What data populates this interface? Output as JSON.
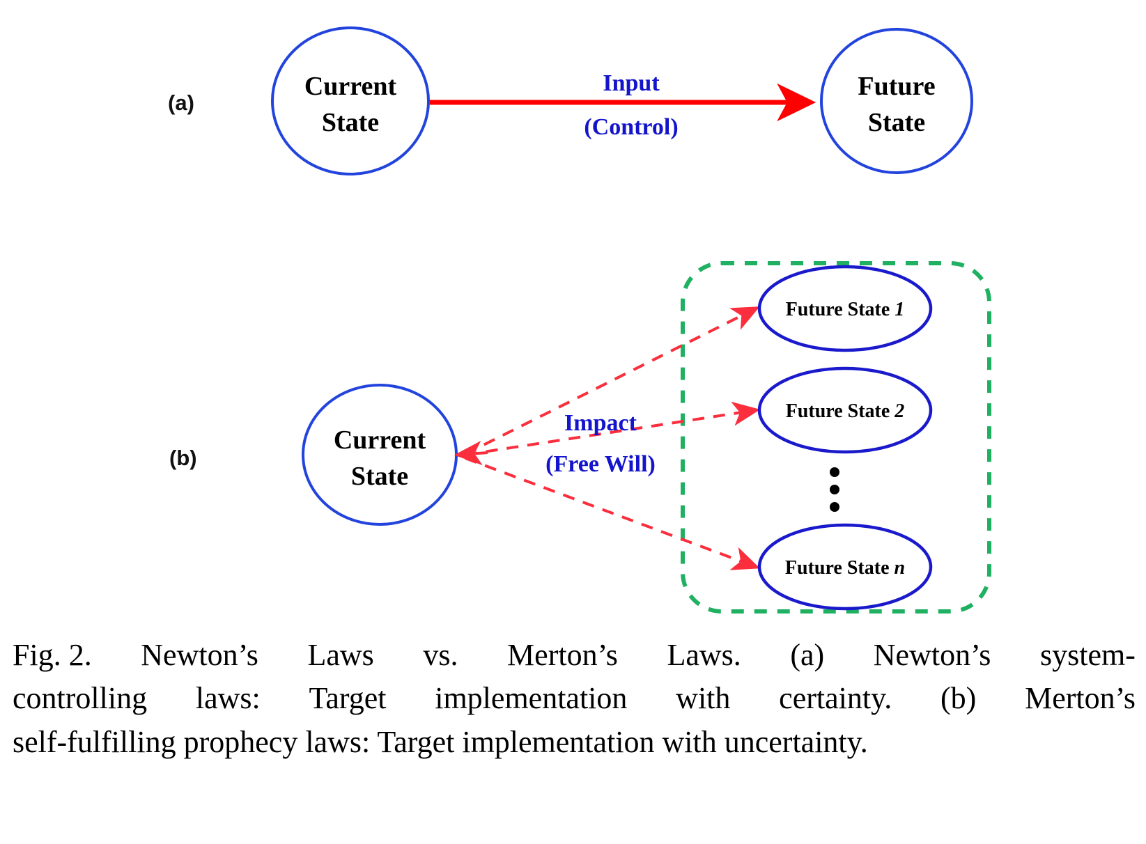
{
  "figure": {
    "panel_a": {
      "label": "(a)",
      "current_state": "Current\nState",
      "current_state_line1": "Current",
      "current_state_line2": "State",
      "future_state_line1": "Future",
      "future_state_line2": "State",
      "edge_label_line1": "Input",
      "edge_label_line2": "(Control)",
      "arrow_style": "solid",
      "arrow_color": "#FF0000",
      "node_stroke_color": "#2244DD",
      "edge_label_color": "#1414CC"
    },
    "panel_b": {
      "label": "(b)",
      "current_state_line1": "Current",
      "current_state_line2": "State",
      "edge_label_line1": "Impact",
      "edge_label_line2": "(Free Will)",
      "arrow_style": "dashed",
      "arrow_color": "#FA2E3C",
      "group_box_color": "#20B061",
      "node_stroke_color": "#1A1ACC",
      "edge_label_color": "#1414CC",
      "vertical_ellipsis": "⋮",
      "future_states": [
        {
          "text": "Future State ",
          "index": "1"
        },
        {
          "text": "Future State ",
          "index": "2"
        },
        {
          "text": "Future State ",
          "index": "n"
        }
      ]
    }
  },
  "caption": {
    "full": "Fig. 2.  Newton’s Laws vs. Merton’s Laws. (a) Newton’s system-controlling laws: Target implementation with certainty. (b) Merton’s self-fulfilling prophecy laws: Target implementation with uncertainty.",
    "line1_a": "Fig. 2.",
    "line1_b": "Newton’s",
    "line1_c": "Laws",
    "line1_d": "vs.",
    "line1_e": "Merton’s",
    "line1_f": "Laws.",
    "line1_g": "(a)",
    "line1_h": "Newton’s",
    "line1_i": "system-",
    "line2_a": "controlling",
    "line2_b": "laws:",
    "line2_c": "Target",
    "line2_d": "implementation",
    "line2_e": "with",
    "line2_f": "certainty.",
    "line2_g": "(b)",
    "line2_h": "Merton’s",
    "line3": "self-fulfilling prophecy laws: Target implementation with uncertainty."
  }
}
